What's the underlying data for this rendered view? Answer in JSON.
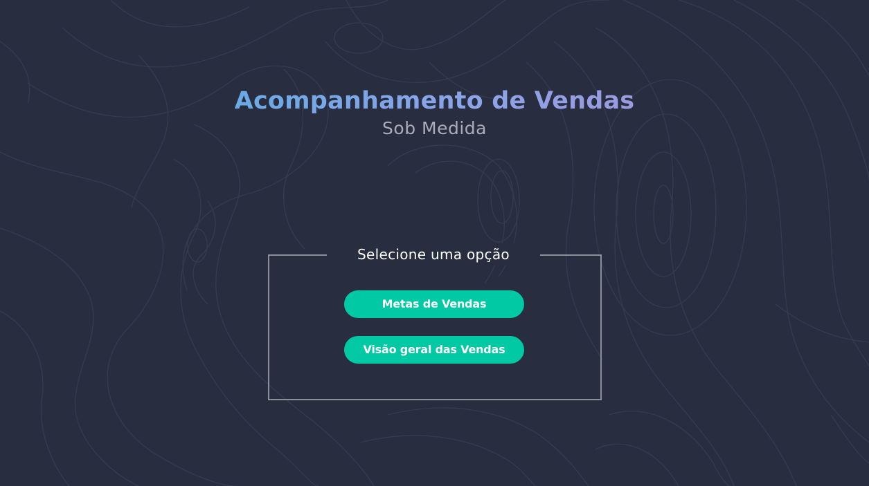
{
  "header": {
    "title": "Acompanhamento de Vendas",
    "subtitle": "Sob Medida"
  },
  "options": {
    "legend": "Selecione uma opção",
    "buttons": [
      {
        "label": "Metas de Vendas"
      },
      {
        "label": "Visão geral das Vendas"
      }
    ]
  },
  "colors": {
    "background": "#282e40",
    "title_gradient_start": "#6aaae6",
    "title_gradient_end": "#9b9be0",
    "button": "#00c9a3",
    "frame_border": "#8b8f9a"
  }
}
